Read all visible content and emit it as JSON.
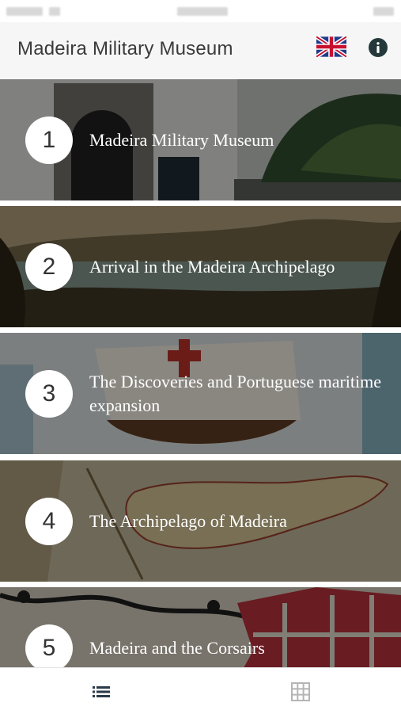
{
  "header": {
    "title": "Madeira Military Museum",
    "language_icon": "uk-flag-icon",
    "info_icon": "info-icon"
  },
  "items": [
    {
      "number": "1",
      "label": "Madeira Military Museum"
    },
    {
      "number": "2",
      "label": "Arrival in the Madeira Archipelago"
    },
    {
      "number": "3",
      "label": "The Discoveries and Portuguese maritime expansion"
    },
    {
      "number": "4",
      "label": "The Archipelago of Madeira"
    },
    {
      "number": "5",
      "label": "Madeira and the Corsairs"
    }
  ],
  "tabbar": {
    "list_icon": "list-icon",
    "grid_icon": "grid-icon",
    "active_color": "#2b3a48",
    "inactive_color": "#b5b5b5"
  }
}
